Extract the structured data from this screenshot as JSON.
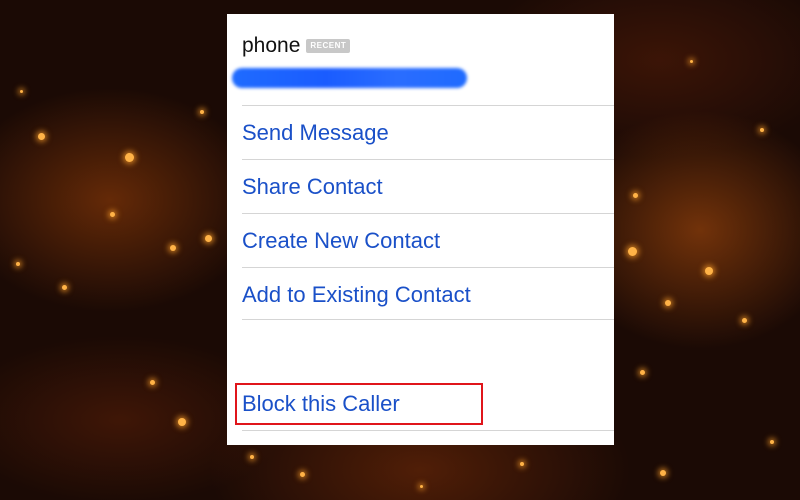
{
  "background": {
    "theme": "dark orange bokeh sparks",
    "accent": "#ffb347"
  },
  "contact_sheet": {
    "field_label": "phone",
    "badge": "RECENT",
    "value_redacted": true,
    "redaction_color": "#1f6bff",
    "actions": [
      {
        "label": "Send Message"
      },
      {
        "label": "Share Contact"
      },
      {
        "label": "Create New Contact"
      },
      {
        "label": "Add to Existing Contact"
      }
    ],
    "block_action": {
      "label": "Block this Caller"
    },
    "link_color": "#1a50c8"
  },
  "annotation": {
    "highlight_color": "#e0151b",
    "target": "block-caller-button"
  }
}
